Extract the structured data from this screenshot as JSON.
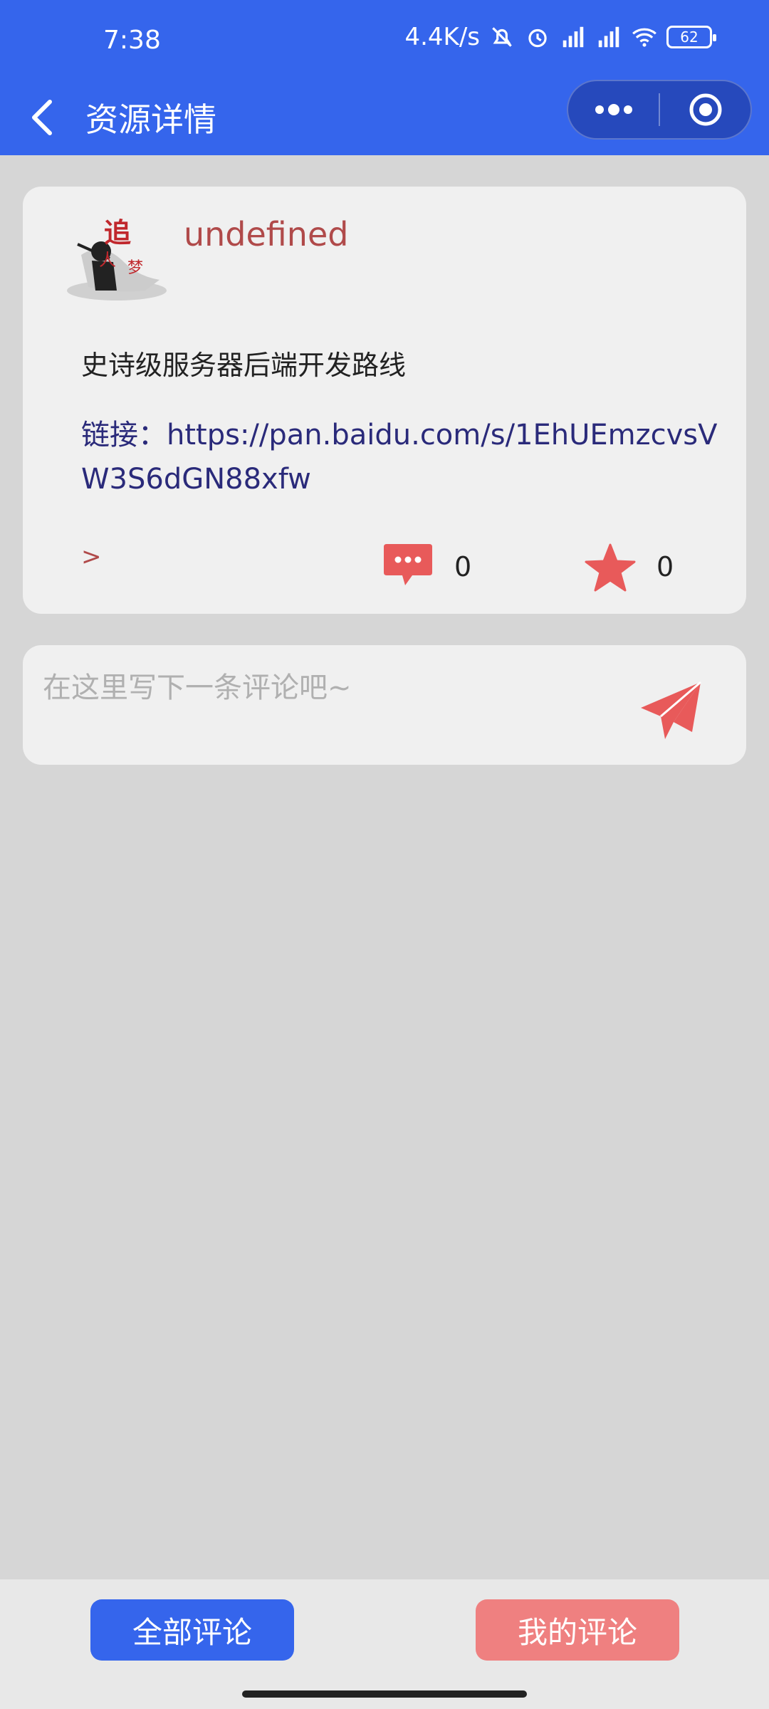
{
  "status": {
    "time": "7:38",
    "net_speed": "4.4K/s",
    "battery": "62"
  },
  "nav": {
    "title": "资源详情"
  },
  "resource": {
    "author": "undefined",
    "title": "史诗级服务器后端开发路线",
    "link": "链接：https://pan.baidu.com/s/1EhUEmzcvsVW3S6dGN88xfw",
    "expand": ">",
    "comment_count": "0",
    "favorite_count": "0"
  },
  "comment_input": {
    "placeholder": "在这里写下一条评论吧~"
  },
  "bottom": {
    "all_comments": "全部评论",
    "my_comments": "我的评论"
  },
  "colors": {
    "primary": "#3565ec",
    "accent": "#e85a5a",
    "author": "#b04a4a",
    "link": "#2a2a7a",
    "mine_button": "#ef8080"
  },
  "icons": [
    "back-icon",
    "more-icon",
    "target-icon",
    "comment-icon",
    "star-icon",
    "send-icon"
  ]
}
